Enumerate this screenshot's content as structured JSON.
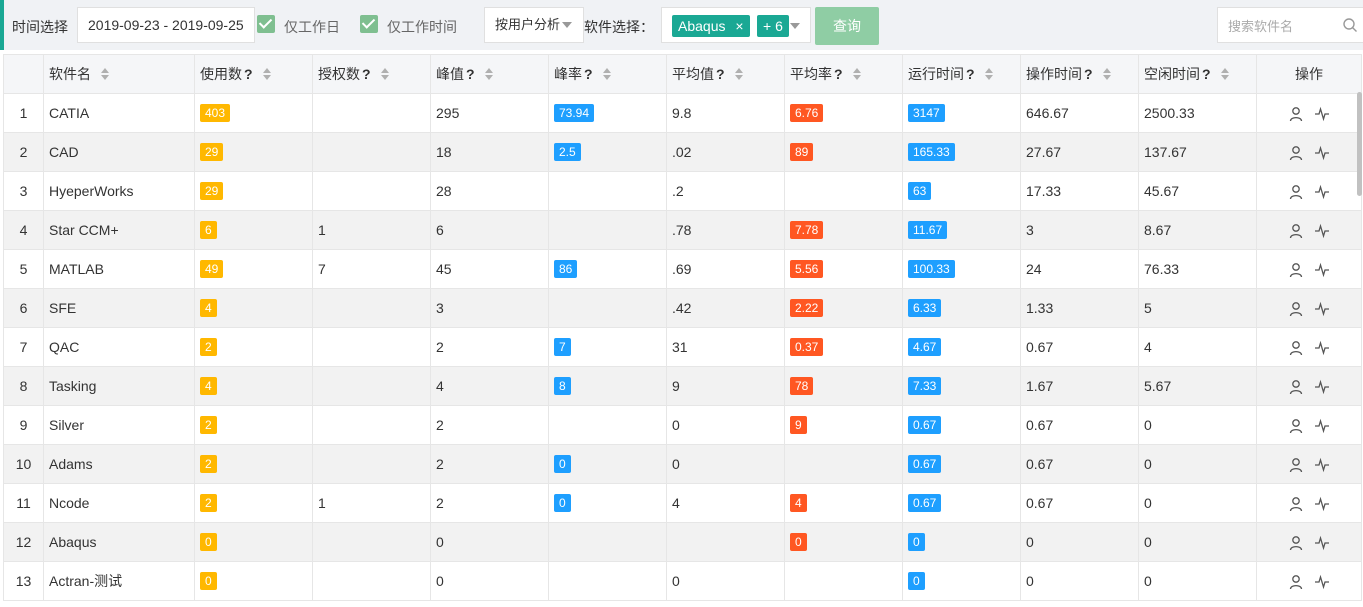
{
  "toolbar": {
    "time_label": "时间选择",
    "date_range": "2019-09-23 - 2019-09-25",
    "workday_label": "仅工作日",
    "worktime_label": "仅工作时间",
    "analysis_select": "按用户分析",
    "software_label": "软件选择：",
    "tag_abaqus": "Abaqus",
    "tag_close": "×",
    "tag_more": "+ 6",
    "query_button": "查询",
    "search_placeholder": "搜索软件名"
  },
  "table": {
    "columns": [
      "",
      "软件名",
      "使用数",
      "授权数",
      "峰值",
      "峰率",
      "平均值",
      "平均率",
      "运行时间",
      "操作时间",
      "空闲时间",
      "操作"
    ],
    "help_mark": "?",
    "rows": [
      {
        "idx": "1",
        "name": "CATIA",
        "usage": "403",
        "auth": "",
        "peak": "295",
        "peak_rate": "73.94",
        "avg": "9.8",
        "avg_rate": "6.76",
        "run": "3147",
        "op": "646.67",
        "idle": "2500.33"
      },
      {
        "idx": "2",
        "name": "CAD",
        "usage": "29",
        "auth": "",
        "peak": "18",
        "peak_rate": "2.5",
        "avg": ".02",
        "avg_rate": "89",
        "run": "165.33",
        "op": "27.67",
        "idle": "137.67"
      },
      {
        "idx": "3",
        "name": "HyeperWorks",
        "usage": "29",
        "auth": "",
        "peak": "28",
        "peak_rate": "",
        "avg": ".2",
        "avg_rate": "",
        "run": "63",
        "op": "17.33",
        "idle": "45.67"
      },
      {
        "idx": "4",
        "name": "Star CCM+",
        "usage": "6",
        "auth": "1",
        "peak": "6",
        "peak_rate": "",
        "avg": ".78",
        "avg_rate": "7.78",
        "run": "11.67",
        "op": "3",
        "idle": "8.67"
      },
      {
        "idx": "5",
        "name": "MATLAB",
        "usage": "49",
        "auth": "7",
        "peak": "45",
        "peak_rate": "86",
        "avg": ".69",
        "avg_rate": "5.56",
        "run": "100.33",
        "op": "24",
        "idle": "76.33"
      },
      {
        "idx": "6",
        "name": "SFE",
        "usage": "4",
        "auth": "",
        "peak": "3",
        "peak_rate": "",
        "avg": ".42",
        "avg_rate": "2.22",
        "run": "6.33",
        "op": "1.33",
        "idle": "5"
      },
      {
        "idx": "7",
        "name": "QAC",
        "usage": "2",
        "auth": "",
        "peak": "2",
        "peak_rate": "7",
        "avg": "31",
        "avg_rate": "0.37",
        "run": "4.67",
        "op": "0.67",
        "idle": "4"
      },
      {
        "idx": "8",
        "name": "Tasking",
        "usage": "4",
        "auth": "",
        "peak": "4",
        "peak_rate": "8",
        "avg": "9",
        "avg_rate": "78",
        "run": "7.33",
        "op": "1.67",
        "idle": "5.67"
      },
      {
        "idx": "9",
        "name": "Silver",
        "usage": "2",
        "auth": "",
        "peak": "2",
        "peak_rate": "",
        "avg": "0",
        "avg_rate": "9",
        "run": "0.67",
        "op": "0.67",
        "idle": "0"
      },
      {
        "idx": "10",
        "name": "Adams",
        "usage": "2",
        "auth": "",
        "peak": "2",
        "peak_rate": "0",
        "avg": "0",
        "avg_rate": "",
        "run": "0.67",
        "op": "0.67",
        "idle": "0"
      },
      {
        "idx": "11",
        "name": "Ncode",
        "usage": "2",
        "auth": "1",
        "peak": "2",
        "peak_rate": "0",
        "avg": "4",
        "avg_rate": "4",
        "run": "0.67",
        "op": "0.67",
        "idle": "0"
      },
      {
        "idx": "12",
        "name": "Abaqus",
        "usage": "0",
        "auth": "",
        "peak": "0",
        "peak_rate": "",
        "avg": "",
        "avg_rate": "0",
        "run": "0",
        "op": "0",
        "idle": "0"
      },
      {
        "idx": "13",
        "name": "Actran-测试",
        "usage": "0",
        "auth": "",
        "peak": "0",
        "peak_rate": "",
        "avg": "0",
        "avg_rate": "",
        "run": "0",
        "op": "0",
        "idle": "0"
      }
    ]
  },
  "colors": {
    "accent": "#1aa894",
    "yellow": "#ffb800",
    "blue": "#1e9fff",
    "orange": "#ff5722"
  },
  "icons": {
    "user": "user-icon",
    "chart": "pulse-chart-icon",
    "search": "search-icon",
    "checkbox": "checkbox-checked-icon"
  }
}
